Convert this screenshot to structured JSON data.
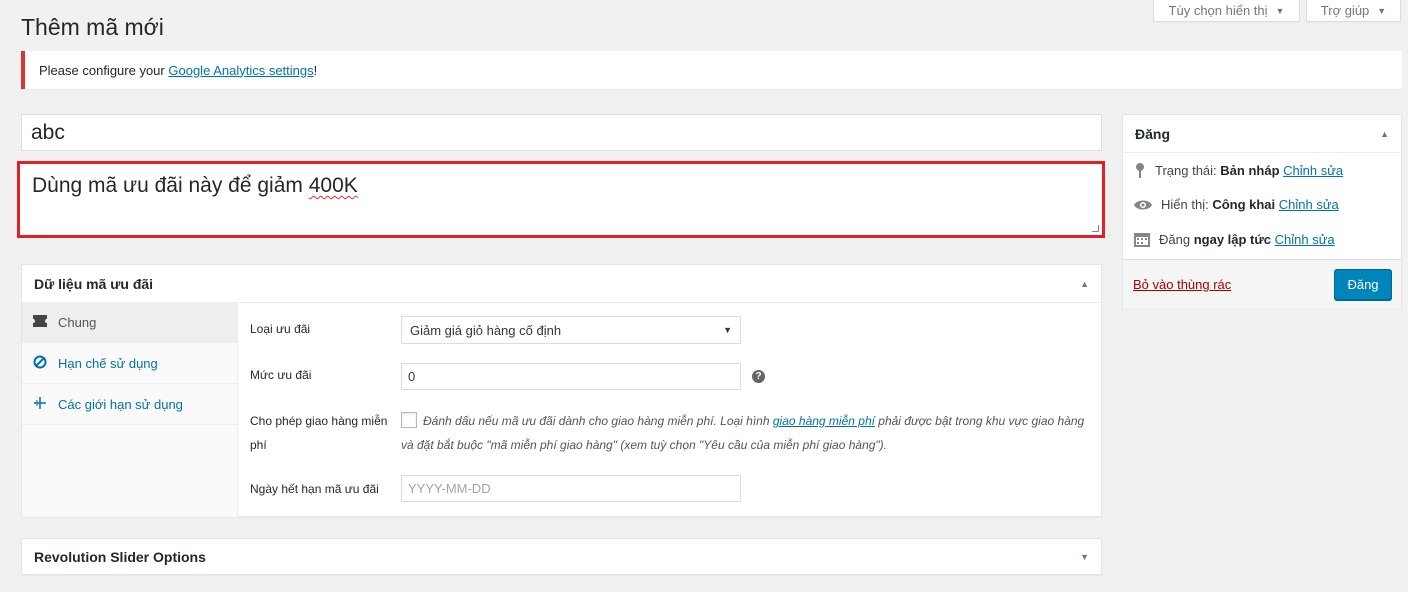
{
  "screen_options": {
    "label": "Tùy chọn hiển thị"
  },
  "help": {
    "label": "Trợ giúp"
  },
  "page": {
    "title": "Thêm mã mới"
  },
  "notice": {
    "prefix": "Please configure your ",
    "link": "Google Analytics settings",
    "suffix": "!"
  },
  "coupon": {
    "code": "abc",
    "description_main": "Dùng mã ưu đãi này để giảm ",
    "description_end": "400K"
  },
  "coupon_data": {
    "title": "Dữ liệu mã ưu đãi",
    "tabs": [
      {
        "label": "Chung",
        "icon": "ticket-icon"
      },
      {
        "label": "Hạn chế sử dụng",
        "icon": "blocked-icon"
      },
      {
        "label": "Các giới hạn sử dụng",
        "icon": "limit-icon"
      }
    ],
    "fields": {
      "discount_type_label": "Loại ưu đãi",
      "discount_type_value": "Giảm giá giỏ hàng cố định",
      "amount_label": "Mức ưu đãi",
      "amount_value": "0",
      "free_shipping_label": "Cho phép giao hàng miễn phí",
      "free_shipping_desc_1": "Đánh dấu nếu mã ưu đãi dành cho giao hàng miễn phí. Loại hình ",
      "free_shipping_link": "giao hàng miễn phí",
      "free_shipping_desc_2": " phải được bật trong khu vực giao hàng và đặt bắt buộc \"mã miễn phí giao hàng\" (xem tuỳ chọn \"Yêu cầu của miễn phí giao hàng\").",
      "expiry_label": "Ngày hết hạn mã ưu đãi",
      "expiry_placeholder": "YYYY-MM-DD"
    }
  },
  "revolution": {
    "title": "Revolution Slider Options"
  },
  "publish": {
    "title": "Đăng",
    "status_label": "Trạng thái: ",
    "status_value": "Bản nháp",
    "visibility_label": "Hiển thị: ",
    "visibility_value": "Công khai",
    "schedule_label": "Đăng ",
    "schedule_value": "ngay lập tức",
    "edit_link": "Chỉnh sửa",
    "trash_link": "Bỏ vào thùng rác",
    "publish_button": "Đăng"
  }
}
